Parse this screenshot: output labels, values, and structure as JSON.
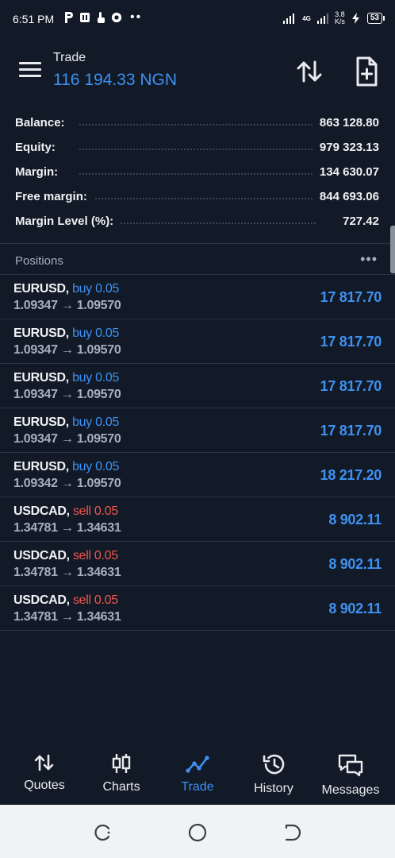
{
  "status_bar": {
    "time": "6:51 PM",
    "network": "4G",
    "speed_value": "3.8",
    "speed_unit": "K/s",
    "battery": "53"
  },
  "app_bar": {
    "title": "Trade",
    "subtitle": "116 194.33 NGN",
    "icons": [
      "menu-icon",
      "sort-icon",
      "new-order-icon"
    ]
  },
  "summary": [
    {
      "label": "Balance:",
      "value": "863 128.80"
    },
    {
      "label": "Equity:",
      "value": "979 323.13"
    },
    {
      "label": "Margin:",
      "value": "134 630.07"
    },
    {
      "label": "Free margin:",
      "value": "844 693.06"
    },
    {
      "label": "Margin Level (%):",
      "value": "727.42"
    }
  ],
  "positions": {
    "title": "Positions",
    "more": "•••",
    "items": [
      {
        "symbol": "EURUSD,",
        "direction": "buy 0.05",
        "prices": "1.09347 → 1.09570",
        "profit": "17 817.70"
      },
      {
        "symbol": "EURUSD,",
        "direction": "buy 0.05",
        "prices": "1.09347 → 1.09570",
        "profit": "17 817.70"
      },
      {
        "symbol": "EURUSD,",
        "direction": "buy 0.05",
        "prices": "1.09347 → 1.09570",
        "profit": "17 817.70"
      },
      {
        "symbol": "EURUSD,",
        "direction": "buy 0.05",
        "prices": "1.09347 → 1.09570",
        "profit": "17 817.70"
      },
      {
        "symbol": "EURUSD,",
        "direction": "buy 0.05",
        "prices": "1.09342 → 1.09570",
        "profit": "18 217.20"
      },
      {
        "symbol": "USDCAD,",
        "direction": "sell 0.05",
        "prices": "1.34781 → 1.34631",
        "profit": "8 902.11"
      },
      {
        "symbol": "USDCAD,",
        "direction": "sell 0.05",
        "prices": "1.34781 → 1.34631",
        "profit": "8 902.11"
      },
      {
        "symbol": "USDCAD,",
        "direction": "sell 0.05",
        "prices": "1.34781 → 1.34631",
        "profit": "8 902.11"
      }
    ]
  },
  "tabs": [
    {
      "label": "Quotes",
      "icon": "quotes-icon",
      "active": false
    },
    {
      "label": "Charts",
      "icon": "charts-icon",
      "active": false
    },
    {
      "label": "Trade",
      "icon": "trade-icon",
      "active": true
    },
    {
      "label": "History",
      "icon": "history-icon",
      "active": false
    },
    {
      "label": "Messages",
      "icon": "messages-icon",
      "active": false
    }
  ],
  "colors": {
    "background": "#121a27",
    "accent_blue": "#3e91f2",
    "sell_red": "#f0554f",
    "muted_text": "#a7b0be"
  }
}
